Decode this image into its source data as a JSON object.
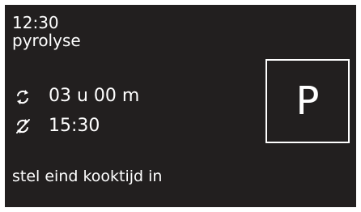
{
  "status": {
    "clock": "12:30",
    "mode": "pyrolyse"
  },
  "timer": {
    "duration_icon": "cycle-arrows-icon",
    "duration": "03 u 00 m",
    "end_icon": "cycle-arrows-crossed-icon",
    "end_time": "15:30"
  },
  "program": {
    "letter": "P"
  },
  "hint": "stel eind kooktijd in",
  "colors": {
    "background": "#221f1f",
    "foreground": "#ffffff"
  }
}
